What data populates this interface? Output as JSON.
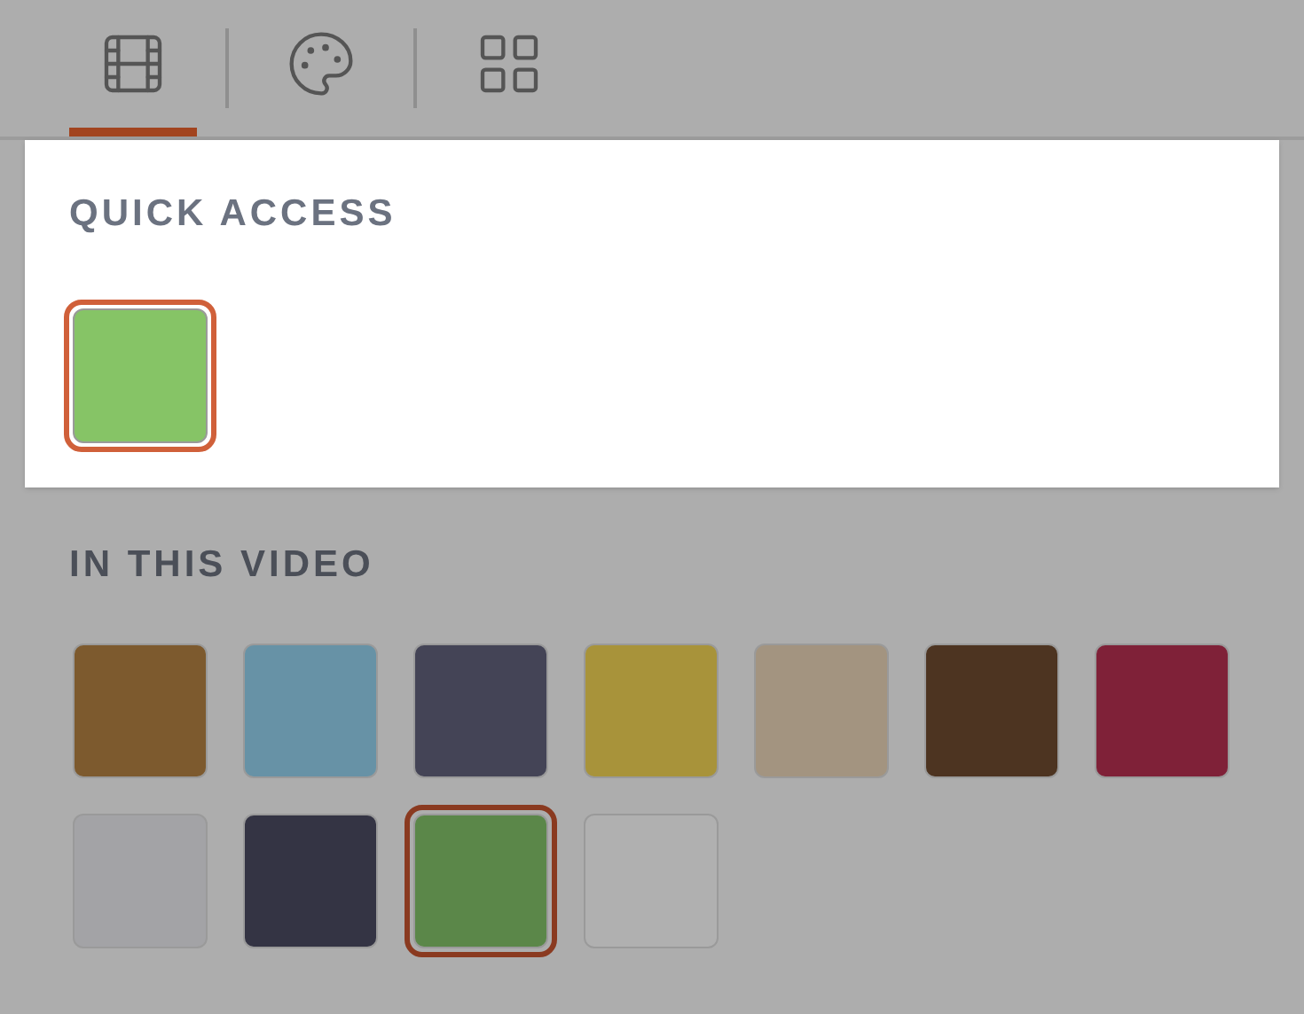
{
  "tabs": [
    {
      "kind": "film",
      "selected": true
    },
    {
      "kind": "palette",
      "selected": false
    },
    {
      "kind": "grid",
      "selected": false
    }
  ],
  "quick_access": {
    "title": "QUICK ACCESS",
    "swatches": [
      {
        "color": "#86c466",
        "selected": true
      }
    ]
  },
  "in_this_video": {
    "title": "IN THIS VIDEO",
    "swatches": [
      {
        "color": "#7d5a2e",
        "selected": false
      },
      {
        "color": "#6792a6",
        "selected": false
      },
      {
        "color": "#444456",
        "selected": false
      },
      {
        "color": "#a8933a",
        "selected": false
      },
      {
        "color": "#a39480",
        "selected": false
      },
      {
        "color": "#4d3421",
        "selected": false
      },
      {
        "color": "#7f2138",
        "selected": false
      },
      {
        "color": "#a3a3a6",
        "selected": false
      },
      {
        "color": "#343444",
        "selected": false
      },
      {
        "color": "#5b8749",
        "selected": true
      },
      {
        "color": "#b0b0b0",
        "selected": false
      }
    ]
  }
}
